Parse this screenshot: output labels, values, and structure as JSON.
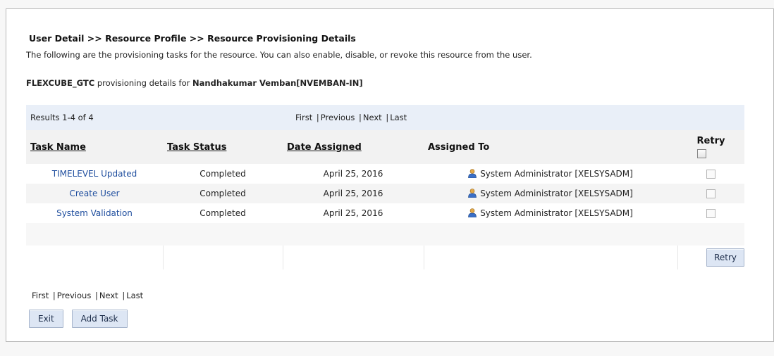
{
  "breadcrumb": "User Detail >> Resource Profile >> Resource Provisioning Details",
  "description": "The following are the provisioning tasks for the resource. You can also enable, disable, or revoke this resource from the user.",
  "details": {
    "resource": "FLEXCUBE_GTC",
    "middle": " provisioning details for ",
    "user": "Nandhakumar Vemban[NVEMBAN-IN]"
  },
  "results_text": "Results 1-4 of 4",
  "pager": {
    "first": "First",
    "previous": "Previous",
    "next": "Next",
    "last": "Last",
    "separator": "|"
  },
  "columns": {
    "task_name": "Task Name",
    "task_status": "Task Status",
    "date_assigned": "Date Assigned",
    "assigned_to": "Assigned To",
    "retry": "Retry"
  },
  "rows": [
    {
      "task_name": "TIMELEVEL Updated",
      "status": "Completed",
      "date": "April 25, 2016",
      "assigned_to": "System Administrator [XELSYSADM]",
      "icon": "user-icon"
    },
    {
      "task_name": "Create User",
      "status": "Completed",
      "date": "April 25, 2016",
      "assigned_to": "System Administrator [XELSYSADM]",
      "icon": "user-icon"
    },
    {
      "task_name": "System Validation",
      "status": "Completed",
      "date": "April 25, 2016",
      "assigned_to": "System Administrator [XELSYSADM]",
      "icon": "user-icon"
    }
  ],
  "buttons": {
    "retry": "Retry",
    "exit": "Exit",
    "add_task": "Add Task"
  },
  "colors": {
    "link": "#1f4e9e",
    "header_band": "#e9eff8",
    "button_bg": "#dde6f4"
  }
}
